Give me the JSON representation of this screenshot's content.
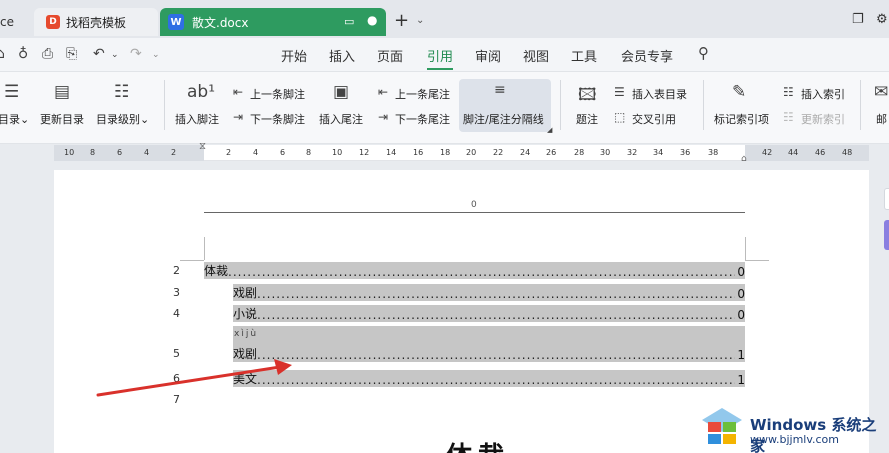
{
  "tabs": {
    "partial_label": "ce",
    "template_label": "找稻壳模板",
    "template_logo": "D",
    "doc_label": "散文.docx",
    "doc_logo": "W"
  },
  "menu": [
    "开始",
    "插入",
    "页面",
    "引用",
    "审阅",
    "视图",
    "工具",
    "会员专享"
  ],
  "menu_active": "引用",
  "ribbon": {
    "toc": "目录",
    "update_toc": "更新目录",
    "toc_level": "目录级别",
    "insert_footnote": "插入脚注",
    "prev_footnote": "上一条脚注",
    "next_footnote": "下一条脚注",
    "insert_endnote": "插入尾注",
    "prev_endnote": "上一条尾注",
    "next_endnote": "下一条尾注",
    "separator": "脚注/尾注分隔线",
    "caption": "题注",
    "insert_table_toc": "插入表目录",
    "cross_ref": "交叉引用",
    "mark_index": "标记索引项",
    "insert_index": "插入索引",
    "update_index": "更新索引",
    "mail": "邮"
  },
  "ruler_numbers": [
    "10",
    "8",
    "6",
    "4",
    "2",
    "2",
    "4",
    "6",
    "8",
    "10",
    "12",
    "14",
    "16",
    "18",
    "20",
    "22",
    "24",
    "26",
    "28",
    "30",
    "32",
    "34",
    "36",
    "38",
    "42",
    "44",
    "46",
    "48"
  ],
  "header_text": "0",
  "toc_entries": [
    {
      "line": "2",
      "text": "体裁",
      "page": "0"
    },
    {
      "line": "3",
      "text": "戏剧",
      "page": "0"
    },
    {
      "line": "4",
      "text": "小说",
      "page": "0"
    },
    {
      "line": "5",
      "text": "戏剧",
      "page": "1"
    },
    {
      "line": "6",
      "text": "美文",
      "page": "1"
    }
  ],
  "line7": "7",
  "pinyin": "xìjù",
  "body_title": "体裁",
  "watermark": {
    "title": "Windows 系统之家",
    "url": "www.bjjmlv.com"
  },
  "colors": {
    "accent": "#2e9b60",
    "highlight": "#c6c6c6",
    "arrow": "#d9312b"
  }
}
